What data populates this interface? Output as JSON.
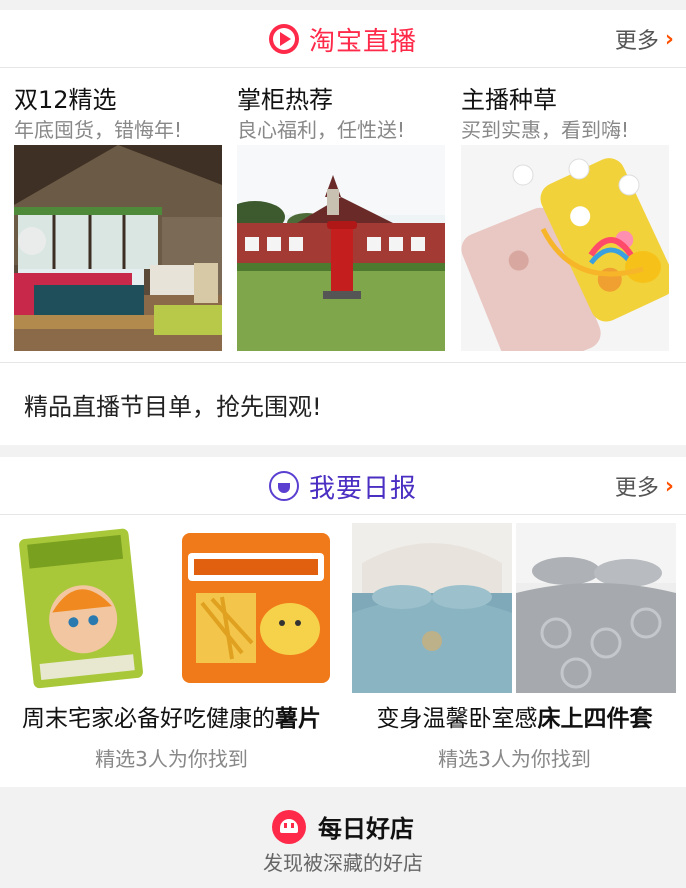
{
  "live": {
    "title": "淘宝直播",
    "more": "更多",
    "columns": [
      {
        "title": "双12精选",
        "subtitle": "年底囤货，错悔年!"
      },
      {
        "title": "掌柜热荐",
        "subtitle": "良心福利，任性送!"
      },
      {
        "title": "主播种草",
        "subtitle": "买到实惠，看到嗨!"
      }
    ],
    "footer": "精品直播节目单，抢先围观!",
    "colors": {
      "accent": "#ff2a4a",
      "more_chevron": "#ff5000"
    }
  },
  "daily": {
    "title": "我要日报",
    "more": "更多",
    "cards": [
      {
        "title_plain": "周末宅家必备好吃健康的",
        "title_bold": "薯片",
        "subtitle": "精选3人为你找到"
      },
      {
        "title_plain": "变身温馨卧室感",
        "title_bold": "床上四件套",
        "subtitle": "精选3人为你找到"
      }
    ],
    "colors": {
      "accent": "#4b2ec2"
    }
  },
  "shop": {
    "title": "每日好店",
    "subtitle": "发现被深藏的好店"
  },
  "icons": [
    "live-play-icon",
    "chevron-right-icon",
    "daily-report-icon",
    "good-shop-icon"
  ]
}
